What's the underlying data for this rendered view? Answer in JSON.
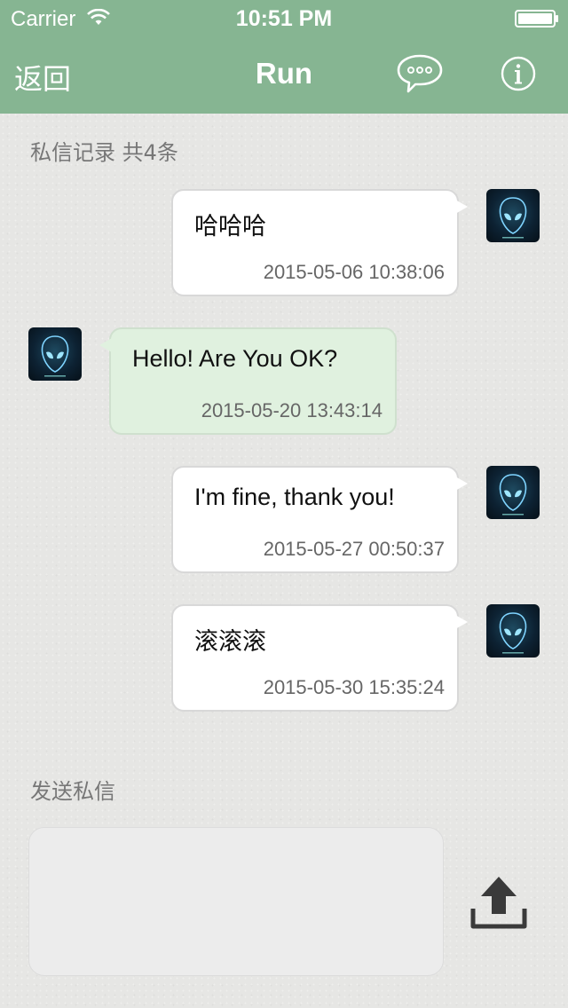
{
  "status_bar": {
    "carrier": "Carrier",
    "time": "10:51 PM"
  },
  "nav": {
    "back_label": "返回",
    "title": "Run"
  },
  "history": {
    "label": "私信记录 共4条",
    "messages": [
      {
        "text": "哈哈哈",
        "time": "2015-05-06 10:38:06",
        "side": "right"
      },
      {
        "text": "Hello! Are You OK?",
        "time": "2015-05-20 13:43:14",
        "side": "left"
      },
      {
        "text": "I'm fine, thank you!",
        "time": "2015-05-27 00:50:37",
        "side": "right"
      },
      {
        "text": "滚滚滚",
        "time": "2015-05-30 15:35:24",
        "side": "right"
      }
    ]
  },
  "compose": {
    "label": "发送私信",
    "value": "",
    "send_icon": "upload-icon"
  },
  "colors": {
    "nav_bg": "#86b592",
    "their_bubble": "#e0f1df",
    "my_bubble": "#ffffff"
  }
}
